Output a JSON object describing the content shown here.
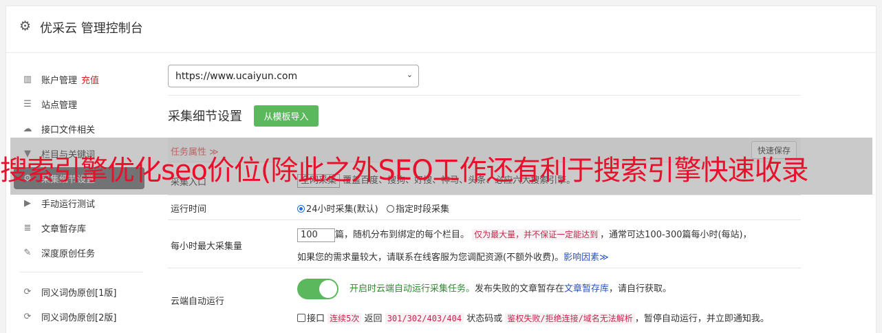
{
  "header": {
    "title": "优采云 管理控制台",
    "icon": "gear-icon"
  },
  "sidebar": {
    "items": [
      {
        "label": "账户管理",
        "badge": "充值",
        "icon": "bar-chart-icon"
      },
      {
        "label": "站点管理",
        "icon": "server-icon"
      },
      {
        "label": "接口文件相关",
        "icon": "cloud-upload-icon"
      },
      {
        "label": "栏目与关键词",
        "icon": "filter-icon"
      },
      {
        "label": "采集细节设置",
        "icon": "gears-icon"
      },
      {
        "label": "手动运行测试",
        "icon": "play-circle-icon"
      },
      {
        "label": "文章暂存库",
        "icon": "database-icon"
      },
      {
        "label": "深度原创任务",
        "icon": "edit-icon"
      },
      {
        "label": "同义词伪原创[1版]",
        "icon": "refresh-icon"
      },
      {
        "label": "同义词伪原创[2版]",
        "icon": "refresh-icon"
      }
    ]
  },
  "site_select": {
    "value": "https://www.ucaiyun.com"
  },
  "section": {
    "title": "采集细节设置",
    "import_button": "从模板导入"
  },
  "table": {
    "task_attr": "任务属性 ≫",
    "quick_save": "快速保存",
    "rows": {
      "entry": {
        "label": "采集入口",
        "select": "全网采集",
        "desc": "覆盖百度、搜狗、好搜、神马、头条、必应六大搜索引擎。"
      },
      "runtime": {
        "label": "运行时间",
        "opt1": "24小时采集(默认)",
        "opt2": "指定时段采集"
      },
      "max_per_hour": {
        "label": "每小时最大采集量",
        "value": "100",
        "text1": "篇，随机分布到绑定的每个栏目。",
        "tag": "仅为最大量，并不保证一定能达到",
        "text2": "，通常可达100-300篇每小时(每站)，",
        "text3": "如果您的需求量较大，请联系在线客服为您调配资源(不额外收费)。",
        "link": "影响因素≫"
      },
      "cloud_run": {
        "label": "云端自动运行",
        "toggle_text": "开启时云端自动运行采集任务。",
        "text1": "发布失败的文章暂存在",
        "link": "文章暂存库",
        "text2": "，请自行获取。",
        "check_label": "接口",
        "tag1": "连续5次",
        "text3": "返回",
        "tag2": "301/302/403/404",
        "text4": "状态码或",
        "tag3": "鉴权失败/拒绝连接/域名无法解析",
        "text5": "，暂停自动运行，并立即通知我。"
      }
    }
  },
  "overlay": {
    "text": "搜索引擎优化seo价位(除此之外SEO工作还有利于搜索引擎快速收录"
  }
}
